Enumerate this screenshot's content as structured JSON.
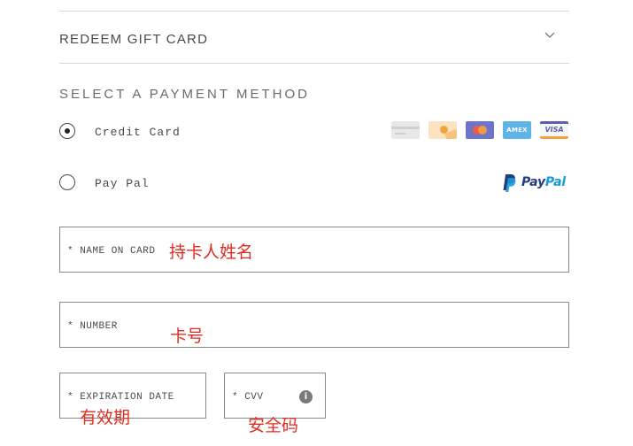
{
  "gift_card": {
    "title": "REDEEM GIFT CARD",
    "toggle_icon": "chevron-down-icon"
  },
  "payment": {
    "section_title": "SELECT A PAYMENT METHOD",
    "options": [
      {
        "label": "Credit Card",
        "selected": true,
        "icons": [
          "generic-card-icon",
          "discover-card-icon",
          "mastercard-icon",
          "amex-card-icon",
          "visa-card-icon"
        ]
      },
      {
        "label": "Pay Pal",
        "selected": false,
        "icons": [
          "paypal-logo"
        ]
      }
    ],
    "amex_text": "AMEX",
    "visa_text": "VISA",
    "paypal_pay": "Pay",
    "paypal_pal": "Pal"
  },
  "fields": {
    "name_on_card": "* NAME ON CARD",
    "number": "* NUMBER",
    "expiration_date": "* EXPIRATION DATE",
    "cvv": "* CVV",
    "cvv_info": "i"
  },
  "annotations": {
    "name_on_card": "持卡人姓名",
    "number": "卡号",
    "expiration_date": "有效期",
    "cvv": "安全码"
  },
  "colors": {
    "annotation": "#e02b20",
    "paypal_dark": "#253b80",
    "paypal_light": "#179bd7",
    "border": "#8a8a8a"
  }
}
